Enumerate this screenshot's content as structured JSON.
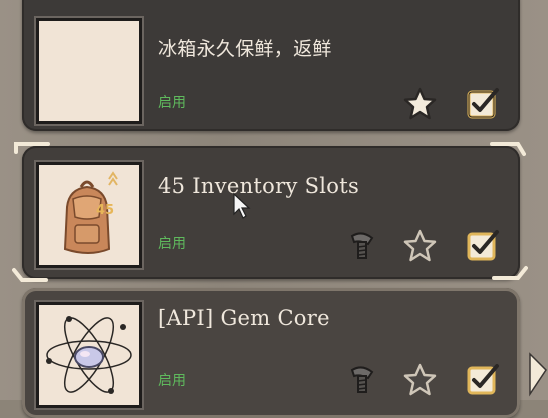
{
  "items": [
    {
      "title": "冰箱永久保鲜，返鲜",
      "status": "启用",
      "thumb_icon": "blank-icon",
      "starred": true,
      "checked": true,
      "locked": false
    },
    {
      "title": "45 Inventory Slots",
      "status": "启用",
      "thumb_icon": "backpack-icon",
      "badge": "45",
      "starred": false,
      "checked": true,
      "locked": true
    },
    {
      "title": "[API] Gem Core",
      "status": "启用",
      "thumb_icon": "gem-atom-icon",
      "starred": false,
      "checked": true,
      "locked": true
    }
  ],
  "colors": {
    "card": "#3d3a38",
    "status": "#5fb95d",
    "text": "#efe7dc",
    "accent": "#e9c56a"
  }
}
